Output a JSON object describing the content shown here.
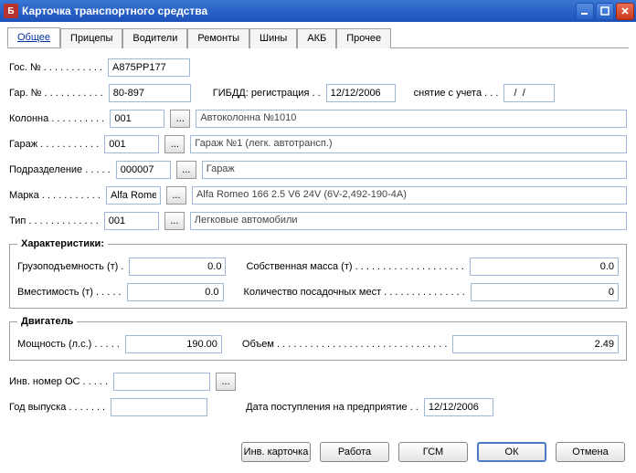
{
  "window": {
    "title": "Карточка транспортного средства",
    "icon_letter": "Б"
  },
  "tabs": [
    "Общее",
    "Прицепы",
    "Водители",
    "Ремонты",
    "Шины",
    "АКБ",
    "Прочее"
  ],
  "labels": {
    "gos_no": "Гос. № . . . . . . . . . . .",
    "gar_no": "Гар. № . . . . . . . . . . .",
    "gibdd_reg": "ГИБДД: регистрация . .",
    "snyatie": "снятие с учета . . .",
    "kolonna": "Колонна . . . . . . . . . .",
    "garage": "Гараж . . . . . . . . . . .",
    "podrazd": "Подразделение . . . . .",
    "marka": "Марка . . . . . . . . . . .",
    "tip": "Тип . . . . . . . . . . . . .",
    "characteristics": "Характеристики:",
    "gruz": "Грузоподъемность (т) .",
    "sobst": "Собственная масса (т) . . . . . . . . . . . . . . . . . . . .",
    "vmest": "Вместимость (т) . . . . .",
    "kolpos": "Количество посадочных мест . . . . . . . . . . . . . . .",
    "dvigatel": "Двигатель",
    "moshch": "Мощность (л.с.) . . . . .",
    "obem": "Объем . . . . . . . . . . . . . . . . . . . . . . . . . . . . . . .",
    "inv": "Инв. номер ОС . . . . .",
    "god": "Год выпуска . . . . . . .",
    "data_post": "Дата поступления на предприятие . ."
  },
  "values": {
    "gos_no": "А875РР177",
    "gar_no": "80-897",
    "gibdd_reg": "12/12/2006",
    "snyatie": "  /  /",
    "kolonna_code": "001",
    "kolonna_text": "Автоколонна №1010",
    "garage_code": "001",
    "garage_text": "Гараж №1 (легк. автотрансп.)",
    "podrazd_code": "000007",
    "podrazd_text": "Гараж",
    "marka_code": "Alfa Romeo",
    "marka_text": "Alfa Romeo 166 2.5 V6 24V (6V-2,492-190-4A)",
    "tip_code": "001",
    "tip_text": "Легковые автомобили",
    "gruz": "0.0",
    "sobst": "0.0",
    "vmest": "0.0",
    "kolpos": "0",
    "moshch": "190.00",
    "obem": "2.49",
    "inv": "",
    "god": "",
    "data_post": "12/12/2006"
  },
  "buttons": {
    "ellipsis": "...",
    "inv_card": "Инв. карточка",
    "rabota": "Работа",
    "gsm": "ГСМ",
    "ok": "ОК",
    "otmena": "Отмена"
  }
}
